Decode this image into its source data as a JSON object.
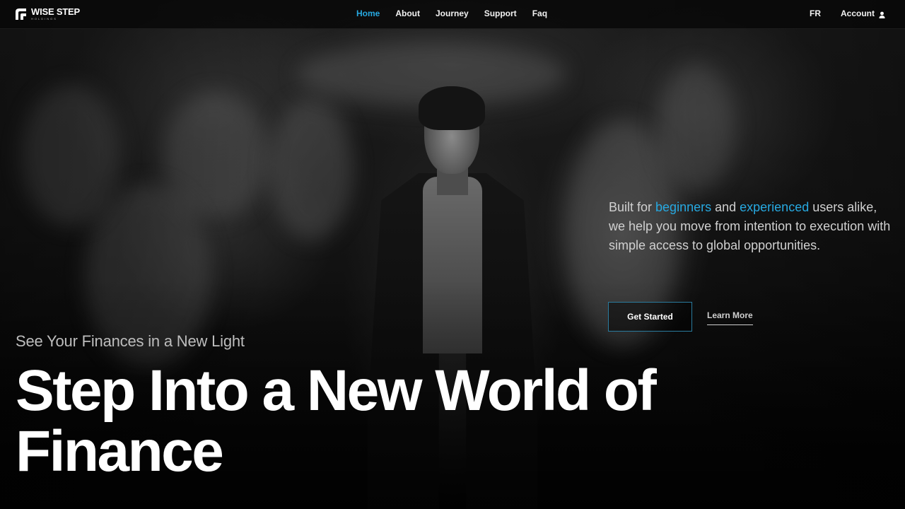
{
  "brand": {
    "name": "WISE STEP",
    "sub": "HOLDINGS"
  },
  "nav": {
    "items": [
      {
        "label": "Home",
        "active": true
      },
      {
        "label": "About",
        "active": false
      },
      {
        "label": "Journey",
        "active": false
      },
      {
        "label": "Support",
        "active": false
      },
      {
        "label": "Faq",
        "active": false
      }
    ],
    "lang": "FR",
    "account": "Account",
    "account_icon": "user-icon"
  },
  "intro": {
    "part1": "Built for ",
    "accent1": "beginners",
    "part2": " and ",
    "accent2": "experienced",
    "part3": " users alike, we help you move from intention to execution with simple access to global opportunities."
  },
  "actions": {
    "primary": "Get Started",
    "secondary": "Learn More"
  },
  "hero": {
    "eyebrow": "See Your Finances in a New Light",
    "headline": "Step Into a New World of Finance"
  },
  "colors": {
    "accent": "#27a9e1",
    "background": "#050505",
    "button_border": "#2a7b9e"
  }
}
